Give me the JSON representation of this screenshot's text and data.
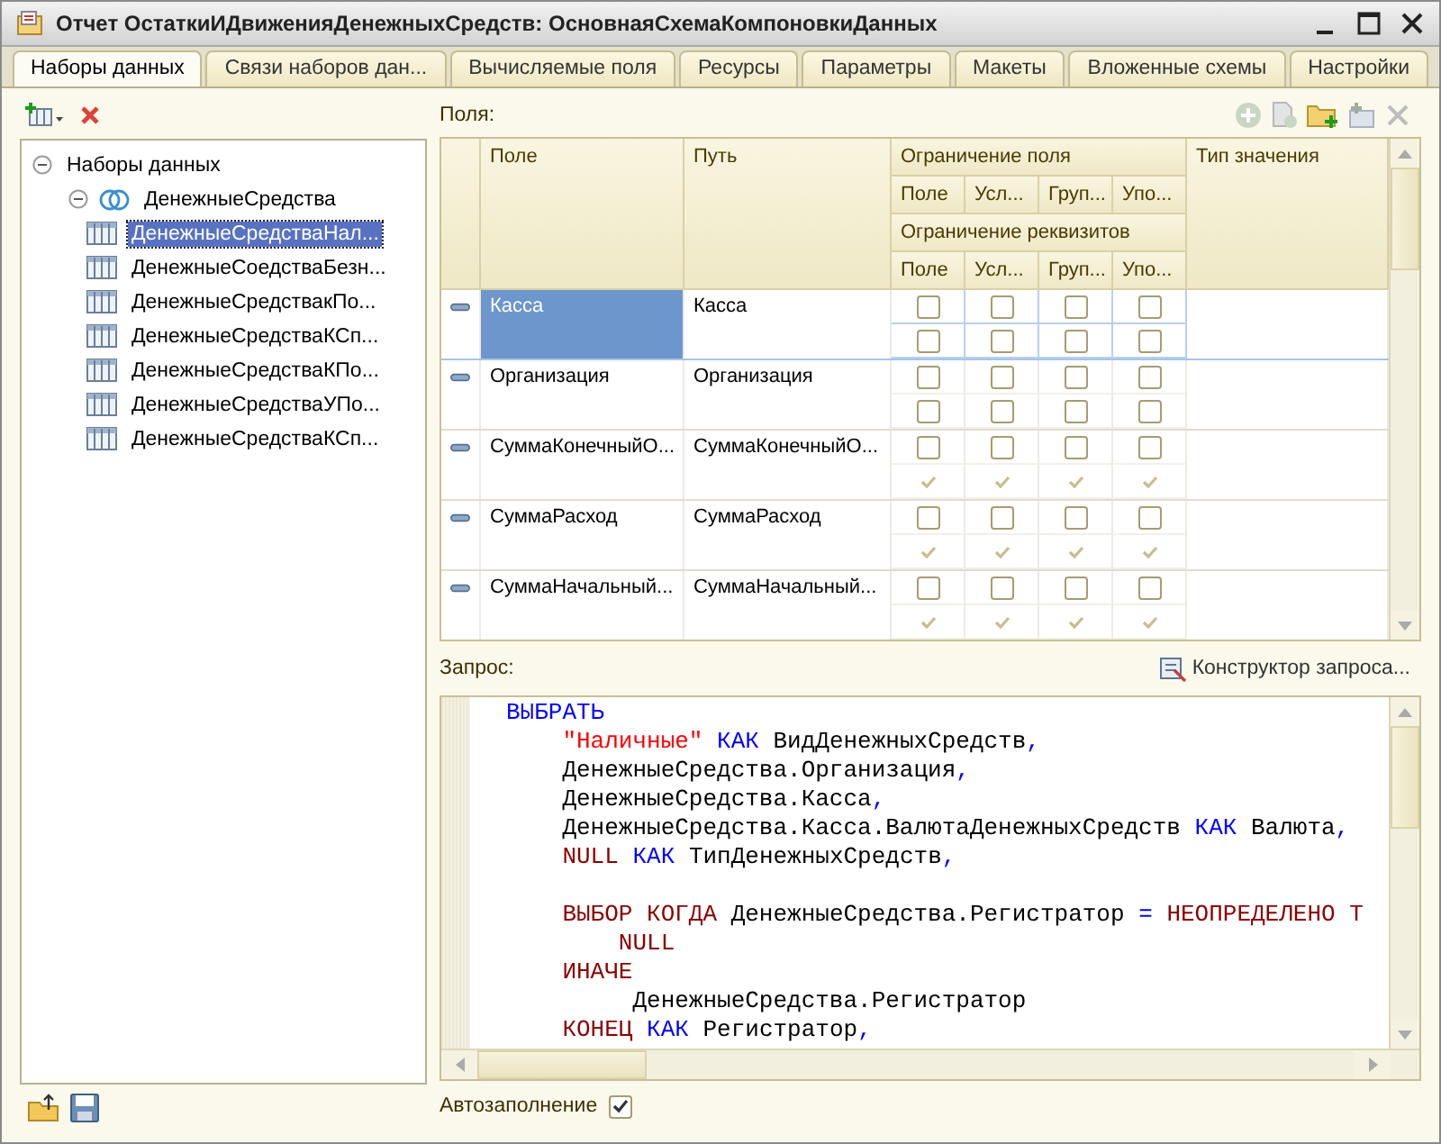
{
  "window": {
    "title": "Отчет ОстаткиИДвиженияДенежныхСредств: ОсновнаяСхемаКомпоновкиДанных"
  },
  "tabs": [
    {
      "label": "Наборы данных",
      "selected": true
    },
    {
      "label": "Связи наборов дан...",
      "selected": false
    },
    {
      "label": "Вычисляемые поля",
      "selected": false
    },
    {
      "label": "Ресурсы",
      "selected": false
    },
    {
      "label": "Параметры",
      "selected": false
    },
    {
      "label": "Макеты",
      "selected": false
    },
    {
      "label": "Вложенные схемы",
      "selected": false
    },
    {
      "label": "Настройки",
      "selected": false
    }
  ],
  "datasets": {
    "tree": [
      {
        "label": "Наборы данных",
        "expanded": true,
        "children": [
          {
            "label": "ДенежныеСредства",
            "kind": "union",
            "expanded": true,
            "children": [
              {
                "label": "ДенежныеСредстваНал...",
                "kind": "query",
                "selected": true
              },
              {
                "label": "ДенежныеСоедстваБезн...",
                "kind": "query",
                "selected": false
              },
              {
                "label": "ДенежныеСредствакПо...",
                "kind": "query",
                "selected": false
              },
              {
                "label": "ДенежныеСредстваКСп...",
                "kind": "query",
                "selected": false
              },
              {
                "label": "ДенежныеСредстваКПо...",
                "kind": "query",
                "selected": false
              },
              {
                "label": "ДенежныеСредстваУПо...",
                "kind": "query",
                "selected": false
              },
              {
                "label": "ДенежныеСредстваКСп...",
                "kind": "query",
                "selected": false
              }
            ]
          }
        ]
      }
    ]
  },
  "fields": {
    "label": "Поля:",
    "columns": {
      "field": "Поле",
      "path": "Путь",
      "field_restriction": "Ограничение поля",
      "attribute_restriction": "Ограничение реквизитов",
      "value_type": "Тип значения",
      "restriction_subcolumns": [
        "Поле",
        "Усл...",
        "Груп...",
        "Упо..."
      ],
      "attribute_subcolumns": [
        "Поле",
        "Усл...",
        "Груп...",
        "Упо..."
      ]
    },
    "rows": [
      {
        "field": "Касса",
        "path": "Касса",
        "selected": true,
        "field_restriction": [
          false,
          false,
          false,
          false
        ],
        "attributes_available": true,
        "attribute_restriction": [
          false,
          false,
          false,
          false
        ]
      },
      {
        "field": "Организация",
        "path": "Организация",
        "selected": false,
        "field_restriction": [
          false,
          false,
          false,
          false
        ],
        "attributes_available": true,
        "attribute_restriction": [
          false,
          false,
          false,
          false
        ]
      },
      {
        "field": "СуммаКонечныйО...",
        "path": "СуммаКонечныйО...",
        "selected": false,
        "field_restriction": [
          false,
          false,
          false,
          false
        ],
        "attributes_available": false
      },
      {
        "field": "СуммаРасход",
        "path": "СуммаРасход",
        "selected": false,
        "field_restriction": [
          false,
          false,
          false,
          false
        ],
        "attributes_available": false
      },
      {
        "field": "СуммаНачальный...",
        "path": "СуммаНачальный...",
        "selected": false,
        "field_restriction": [
          false,
          false,
          false,
          false
        ],
        "attributes_available": false
      }
    ]
  },
  "query": {
    "label": "Запрос:",
    "constructor_button": "Конструктор запроса...",
    "code_lines": [
      {
        "kind": "code",
        "tokens": [
          {
            "kind": "keyword",
            "text": "ВЫБРАТЬ"
          }
        ]
      },
      {
        "kind": "code",
        "tokens": [
          {
            "kind": "string",
            "text": "    \"Наличные\""
          },
          {
            "kind": "keyword",
            "text": " КАК"
          },
          {
            "kind": "text",
            "text": " ВидДенежныхСредств"
          },
          {
            "kind": "punct",
            "text": ","
          }
        ]
      },
      {
        "kind": "code",
        "tokens": [
          {
            "kind": "text",
            "text": "    ДенежныеСредства.Организация"
          },
          {
            "kind": "punct",
            "text": ","
          }
        ]
      },
      {
        "kind": "code",
        "tokens": [
          {
            "kind": "text",
            "text": "    ДенежныеСредства.Касса"
          },
          {
            "kind": "punct",
            "text": ","
          }
        ]
      },
      {
        "kind": "code",
        "tokens": [
          {
            "kind": "text",
            "text": "    ДенежныеСредства.Касса.ВалютаДенежныхСредств"
          },
          {
            "kind": "keyword",
            "text": " КАК"
          },
          {
            "kind": "text",
            "text": " Валюта"
          },
          {
            "kind": "punct",
            "text": ","
          }
        ]
      },
      {
        "kind": "code",
        "tokens": [
          {
            "kind": "construct",
            "text": "    NULL"
          },
          {
            "kind": "keyword",
            "text": " КАК"
          },
          {
            "kind": "text",
            "text": " ТипДенежныхСредств"
          },
          {
            "kind": "punct",
            "text": ","
          }
        ]
      },
      {
        "kind": "blank"
      },
      {
        "kind": "code",
        "tokens": [
          {
            "kind": "construct",
            "text": "    ВЫБОР КОГДА"
          },
          {
            "kind": "text",
            "text": " ДенежныеСредства.Регистратор"
          },
          {
            "kind": "punct",
            "text": " ="
          },
          {
            "kind": "construct",
            "text": " НЕОПРЕДЕЛЕНО Т"
          }
        ]
      },
      {
        "kind": "code",
        "tokens": [
          {
            "kind": "construct",
            "text": "        NULL"
          }
        ]
      },
      {
        "kind": "code",
        "tokens": [
          {
            "kind": "construct",
            "text": "    ИНАЧЕ"
          }
        ]
      },
      {
        "kind": "code",
        "tokens": [
          {
            "kind": "text",
            "text": "         ДенежныеСредства.Регистратор"
          }
        ]
      },
      {
        "kind": "code",
        "tokens": [
          {
            "kind": "construct",
            "text": "    КОНЕЦ"
          },
          {
            "kind": "keyword",
            "text": " КАК"
          },
          {
            "kind": "text",
            "text": " Регистратор"
          },
          {
            "kind": "punct",
            "text": ","
          }
        ]
      }
    ]
  },
  "autofill": {
    "label": "Автозаполнение",
    "checked": true
  }
}
